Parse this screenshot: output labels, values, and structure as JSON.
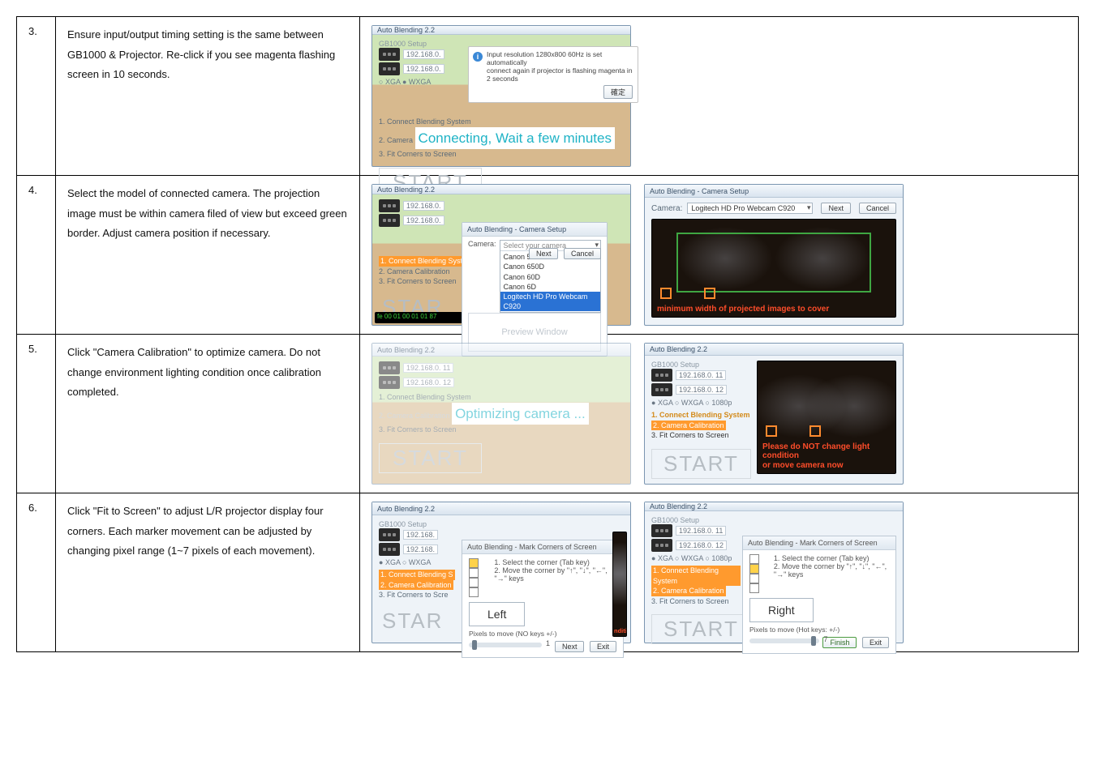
{
  "rows": [
    {
      "num": "3.",
      "desc": "Ensure input/output timing setting is the same between GB1000 & Projector. Re-click if you see magenta flashing screen in 10 seconds."
    },
    {
      "num": "4.",
      "desc": "Select the model of connected camera. The projection image must be within camera filed of view but exceed green border. Adjust camera position if necessary."
    },
    {
      "num": "5.",
      "desc": "Click \"Camera Calibration\" to optimize camera. Do not change environment lighting condition once calibration completed."
    },
    {
      "num": "6.",
      "desc": "Click \"Fit to Screen\" to adjust L/R projector display four corners. Each marker movement can be adjusted by changing pixel range (1~7 pixels of each movement)."
    }
  ],
  "common": {
    "app_title": "Auto Blending 2.2",
    "gb_header": "GB1000 Setup",
    "start": "START",
    "star": "STAR",
    "next": "Next",
    "cancel": "Cancel",
    "exit": "Exit",
    "finish": "Finish",
    "ok": "確定",
    "ip1": "192.168.0.",
    "ip11": "192.168.0. 11",
    "ip12": "192.168.0. 12",
    "res_xga": "XGA",
    "res_wxga": "WXGA",
    "res_1080p": "1080p",
    "step1": "1. Connect Blending System",
    "step2": "2. Camera Calibration",
    "step3": "3. Fit Corners to Screen"
  },
  "shot3": {
    "info_line1": "Input resolution 1280x800 60Hz is set automatically",
    "info_line2": "connect again if projector is flashing magenta in 2 seconds",
    "status_prefix": "2. Camera",
    "status_msg": "Connecting, Wait a few minutes"
  },
  "shot4a": {
    "dialog_title": "Auto Blending - Camera Setup",
    "camera_label": "Camera:",
    "sel_placeholder": "Select your camera",
    "options": [
      "Canon 500D",
      "Canon 650D",
      "Canon 60D",
      "Canon 6D",
      "Logitech HD Pro Webcam C920"
    ],
    "preview": "Preview Window",
    "hex_line": "fe 00 01 00 01 01 87"
  },
  "shot4b": {
    "dialog_title": "Auto Blending - Camera Setup",
    "camera_label": "Camera:",
    "selected": "Logitech HD Pro Webcam C920",
    "caption": "minimum width of projected images to cover"
  },
  "shot5a": {
    "status": "Optimizing camera ..."
  },
  "shot5b": {
    "caption1": "Please do NOT change light condition",
    "caption2": "or move camera now"
  },
  "shot6": {
    "dialog_title": "Auto Blending - Mark Corners of Screen",
    "line1": "1. Select the corner (Tab key)",
    "line2": "2. Move the corner by \"↑\", \"↓\", \"←\", \"→\" keys",
    "pixels_label_a": "Pixels to move (NO keys +/-)",
    "pixels_label_b": "Pixels to move (Hot keys: +/-)",
    "ipA": "192.168.",
    "left": "Left",
    "right": "Right",
    "pix_a_val": "1",
    "pix_b_val": "7",
    "small_caption": "ndition"
  }
}
